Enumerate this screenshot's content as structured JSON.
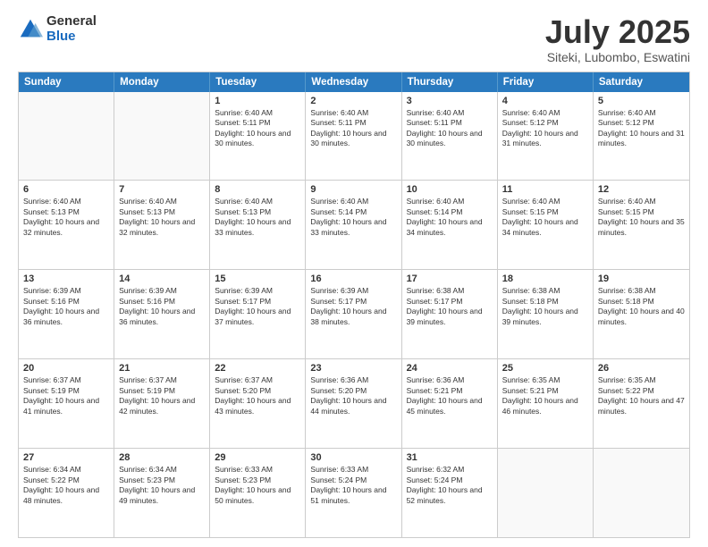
{
  "logo": {
    "general": "General",
    "blue": "Blue"
  },
  "title": {
    "month": "July 2025",
    "location": "Siteki, Lubombo, Eswatini"
  },
  "days_of_week": [
    "Sunday",
    "Monday",
    "Tuesday",
    "Wednesday",
    "Thursday",
    "Friday",
    "Saturday"
  ],
  "weeks": [
    [
      {
        "day": "",
        "info": ""
      },
      {
        "day": "",
        "info": ""
      },
      {
        "day": "1",
        "info": "Sunrise: 6:40 AM\nSunset: 5:11 PM\nDaylight: 10 hours and 30 minutes."
      },
      {
        "day": "2",
        "info": "Sunrise: 6:40 AM\nSunset: 5:11 PM\nDaylight: 10 hours and 30 minutes."
      },
      {
        "day": "3",
        "info": "Sunrise: 6:40 AM\nSunset: 5:11 PM\nDaylight: 10 hours and 30 minutes."
      },
      {
        "day": "4",
        "info": "Sunrise: 6:40 AM\nSunset: 5:12 PM\nDaylight: 10 hours and 31 minutes."
      },
      {
        "day": "5",
        "info": "Sunrise: 6:40 AM\nSunset: 5:12 PM\nDaylight: 10 hours and 31 minutes."
      }
    ],
    [
      {
        "day": "6",
        "info": "Sunrise: 6:40 AM\nSunset: 5:13 PM\nDaylight: 10 hours and 32 minutes."
      },
      {
        "day": "7",
        "info": "Sunrise: 6:40 AM\nSunset: 5:13 PM\nDaylight: 10 hours and 32 minutes."
      },
      {
        "day": "8",
        "info": "Sunrise: 6:40 AM\nSunset: 5:13 PM\nDaylight: 10 hours and 33 minutes."
      },
      {
        "day": "9",
        "info": "Sunrise: 6:40 AM\nSunset: 5:14 PM\nDaylight: 10 hours and 33 minutes."
      },
      {
        "day": "10",
        "info": "Sunrise: 6:40 AM\nSunset: 5:14 PM\nDaylight: 10 hours and 34 minutes."
      },
      {
        "day": "11",
        "info": "Sunrise: 6:40 AM\nSunset: 5:15 PM\nDaylight: 10 hours and 34 minutes."
      },
      {
        "day": "12",
        "info": "Sunrise: 6:40 AM\nSunset: 5:15 PM\nDaylight: 10 hours and 35 minutes."
      }
    ],
    [
      {
        "day": "13",
        "info": "Sunrise: 6:39 AM\nSunset: 5:16 PM\nDaylight: 10 hours and 36 minutes."
      },
      {
        "day": "14",
        "info": "Sunrise: 6:39 AM\nSunset: 5:16 PM\nDaylight: 10 hours and 36 minutes."
      },
      {
        "day": "15",
        "info": "Sunrise: 6:39 AM\nSunset: 5:17 PM\nDaylight: 10 hours and 37 minutes."
      },
      {
        "day": "16",
        "info": "Sunrise: 6:39 AM\nSunset: 5:17 PM\nDaylight: 10 hours and 38 minutes."
      },
      {
        "day": "17",
        "info": "Sunrise: 6:38 AM\nSunset: 5:17 PM\nDaylight: 10 hours and 39 minutes."
      },
      {
        "day": "18",
        "info": "Sunrise: 6:38 AM\nSunset: 5:18 PM\nDaylight: 10 hours and 39 minutes."
      },
      {
        "day": "19",
        "info": "Sunrise: 6:38 AM\nSunset: 5:18 PM\nDaylight: 10 hours and 40 minutes."
      }
    ],
    [
      {
        "day": "20",
        "info": "Sunrise: 6:37 AM\nSunset: 5:19 PM\nDaylight: 10 hours and 41 minutes."
      },
      {
        "day": "21",
        "info": "Sunrise: 6:37 AM\nSunset: 5:19 PM\nDaylight: 10 hours and 42 minutes."
      },
      {
        "day": "22",
        "info": "Sunrise: 6:37 AM\nSunset: 5:20 PM\nDaylight: 10 hours and 43 minutes."
      },
      {
        "day": "23",
        "info": "Sunrise: 6:36 AM\nSunset: 5:20 PM\nDaylight: 10 hours and 44 minutes."
      },
      {
        "day": "24",
        "info": "Sunrise: 6:36 AM\nSunset: 5:21 PM\nDaylight: 10 hours and 45 minutes."
      },
      {
        "day": "25",
        "info": "Sunrise: 6:35 AM\nSunset: 5:21 PM\nDaylight: 10 hours and 46 minutes."
      },
      {
        "day": "26",
        "info": "Sunrise: 6:35 AM\nSunset: 5:22 PM\nDaylight: 10 hours and 47 minutes."
      }
    ],
    [
      {
        "day": "27",
        "info": "Sunrise: 6:34 AM\nSunset: 5:22 PM\nDaylight: 10 hours and 48 minutes."
      },
      {
        "day": "28",
        "info": "Sunrise: 6:34 AM\nSunset: 5:23 PM\nDaylight: 10 hours and 49 minutes."
      },
      {
        "day": "29",
        "info": "Sunrise: 6:33 AM\nSunset: 5:23 PM\nDaylight: 10 hours and 50 minutes."
      },
      {
        "day": "30",
        "info": "Sunrise: 6:33 AM\nSunset: 5:24 PM\nDaylight: 10 hours and 51 minutes."
      },
      {
        "day": "31",
        "info": "Sunrise: 6:32 AM\nSunset: 5:24 PM\nDaylight: 10 hours and 52 minutes."
      },
      {
        "day": "",
        "info": ""
      },
      {
        "day": "",
        "info": ""
      }
    ]
  ]
}
